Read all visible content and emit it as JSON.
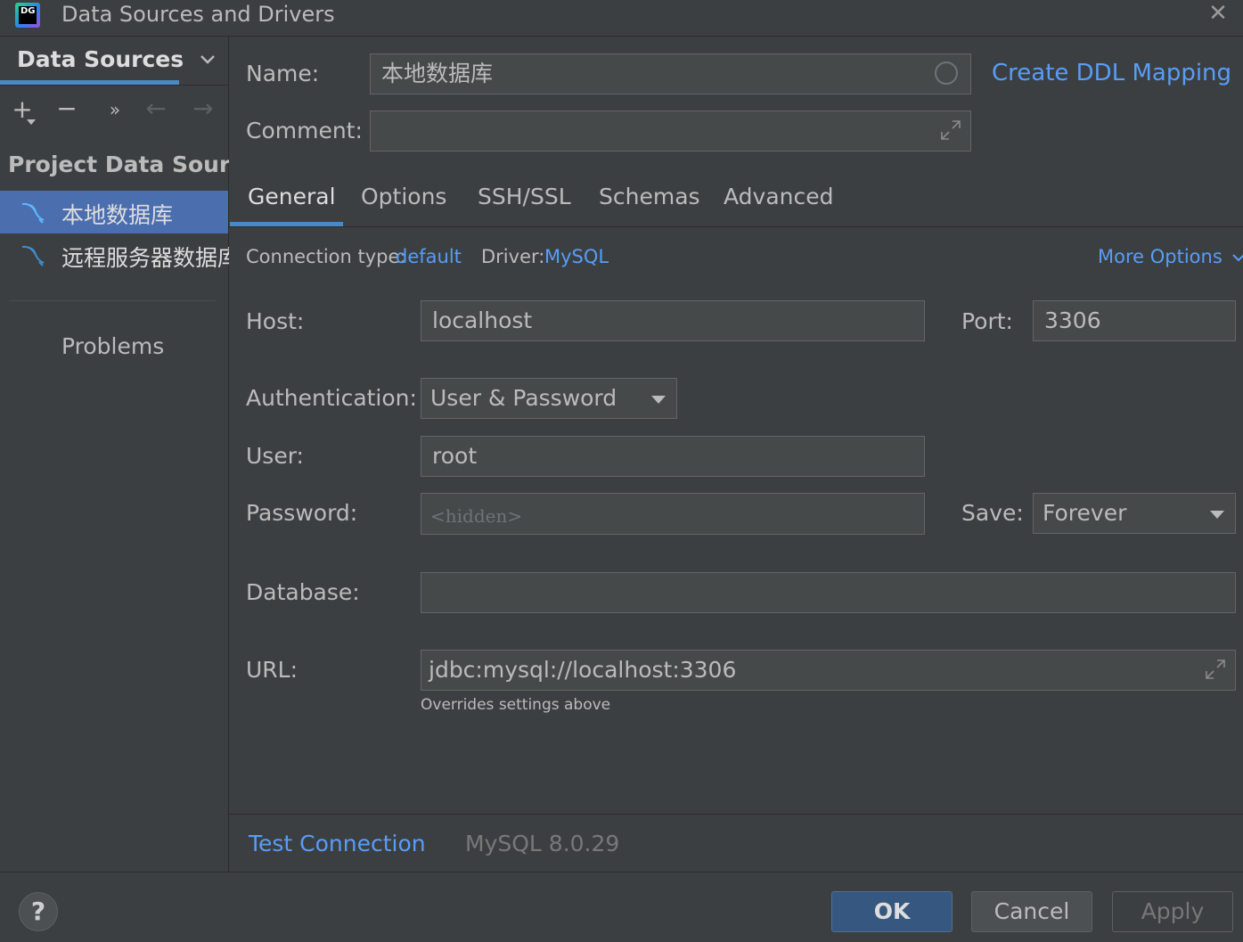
{
  "window": {
    "app_logo_text": "DG",
    "title": "Data Sources and Drivers",
    "close_glyph": "✕"
  },
  "sidebar": {
    "tab_label": "Data Sources",
    "section_title": "Project Data Sources",
    "items": [
      {
        "label": "本地数据库",
        "selected": true
      },
      {
        "label": "远程服务器数据库",
        "selected": false
      }
    ],
    "problems_label": "Problems",
    "toolbar": {
      "add": "+",
      "remove": "−",
      "more": "»",
      "back": "←",
      "forward": "→"
    }
  },
  "form": {
    "name_label": "Name:",
    "name_value": "本地数据库",
    "comment_label": "Comment:",
    "comment_value": "",
    "create_ddl_link": "Create DDL Mapping",
    "tabs": [
      {
        "label": "General",
        "active": true
      },
      {
        "label": "Options",
        "active": false
      },
      {
        "label": "SSH/SSL",
        "active": false
      },
      {
        "label": "Schemas",
        "active": false
      },
      {
        "label": "Advanced",
        "active": false
      }
    ],
    "connection_type_label": "Connection type:",
    "connection_type_value": "default",
    "driver_label": "Driver:",
    "driver_value": "MySQL",
    "more_options": "More Options",
    "host_label": "Host:",
    "host_value": "localhost",
    "port_label": "Port:",
    "port_value": "3306",
    "auth_label": "Authentication:",
    "auth_value": "User & Password",
    "user_label": "User:",
    "user_value": "root",
    "password_label": "Password:",
    "password_placeholder": "<hidden>",
    "save_label": "Save:",
    "save_value": "Forever",
    "database_label": "Database:",
    "database_value": "",
    "url_label": "URL:",
    "url_value": "jdbc:mysql://localhost:3306",
    "url_hint": "Overrides settings above"
  },
  "test": {
    "link": "Test Connection",
    "version": "MySQL 8.0.29"
  },
  "footer": {
    "help": "?",
    "ok": "OK",
    "cancel": "Cancel",
    "apply": "Apply"
  },
  "colors": {
    "background": "#3c3f41",
    "selection": "#4b6eaf",
    "link": "#589df6",
    "accent_underline": "#4a88c7",
    "primary_button": "#365880"
  }
}
